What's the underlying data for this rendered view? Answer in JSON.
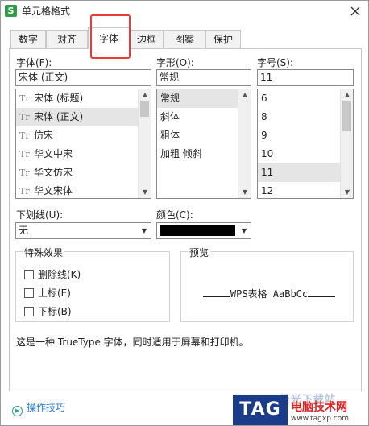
{
  "window": {
    "title": "单元格格式",
    "app_icon": "S"
  },
  "tabs": [
    {
      "label": "数字"
    },
    {
      "label": "对齐"
    },
    {
      "label": "字体"
    },
    {
      "label": "边框"
    },
    {
      "label": "图案"
    },
    {
      "label": "保护"
    }
  ],
  "active_tab": "字体",
  "font": {
    "label": "字体(F):",
    "value": "宋体 (正文)",
    "items": [
      "宋体 (标题)",
      "宋体 (正文)",
      "仿宋",
      "华文中宋",
      "华文仿宋",
      "华文宋体"
    ],
    "selected": "宋体 (正文)"
  },
  "style": {
    "label": "字形(O):",
    "value": "常规",
    "items": [
      "常规",
      "斜体",
      "粗体",
      "加粗 倾斜"
    ],
    "selected": "常规"
  },
  "size": {
    "label": "字号(S):",
    "value": "11",
    "items": [
      "6",
      "8",
      "9",
      "10",
      "11",
      "12"
    ],
    "selected": "11"
  },
  "underline": {
    "label": "下划线(U):",
    "value": "无"
  },
  "color": {
    "label": "颜色(C):",
    "swatch": "#000000"
  },
  "effects": {
    "legend": "特殊效果",
    "items": [
      {
        "label": "删除线(K)",
        "checked": false
      },
      {
        "label": "上标(E)",
        "checked": false
      },
      {
        "label": "下标(B)",
        "checked": false
      }
    ]
  },
  "preview": {
    "legend": "预览",
    "sample": "WPS表格  AaBbCc"
  },
  "description": "这是一种 TrueType 字体，同时适用于屏幕和打印机。",
  "footer": {
    "tip_label": "操作技巧"
  },
  "watermark": {
    "logo": "TAG",
    "top": "极光下载站",
    "cn": "电脑技术网",
    "url": "www.tagxp.com"
  },
  "colors": {
    "accent_highlight": "#e53b3b",
    "tip_link": "#2b7de0",
    "selected_row": "#e5e5e5"
  }
}
